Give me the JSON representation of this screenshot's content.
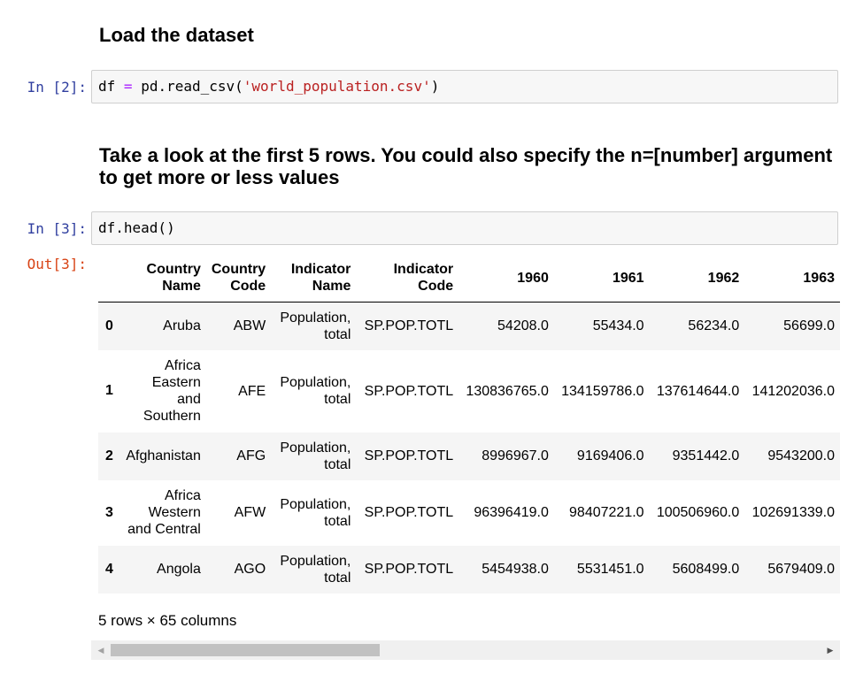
{
  "cells": [
    {
      "kind": "markdown",
      "text": "Load the dataset"
    },
    {
      "kind": "code",
      "prompt": "In [2]:",
      "code": {
        "var": "df",
        "op": "=",
        "call": "pd.read_csv(",
        "arg": "'world_population.csv'",
        "close": ")"
      }
    },
    {
      "kind": "markdown",
      "text": "Take a look at the first 5 rows. You could also specify the n=[number] argument to get more or less values"
    },
    {
      "kind": "code",
      "prompt": "In [3]:",
      "code": {
        "text": "df.head()"
      }
    }
  ],
  "output": {
    "prompt": "Out[3]:",
    "table": {
      "columns": [
        "",
        "Country Name",
        "Country Code",
        "Indicator Name",
        "Indicator Code",
        "1960",
        "1961",
        "1962",
        "1963"
      ],
      "rows": [
        [
          "0",
          "Aruba",
          "ABW",
          "Population, total",
          "SP.POP.TOTL",
          "54208.0",
          "55434.0",
          "56234.0",
          "56699.0"
        ],
        [
          "1",
          "Africa Eastern and Southern",
          "AFE",
          "Population, total",
          "SP.POP.TOTL",
          "130836765.0",
          "134159786.0",
          "137614644.0",
          "141202036.0"
        ],
        [
          "2",
          "Afghanistan",
          "AFG",
          "Population, total",
          "SP.POP.TOTL",
          "8996967.0",
          "9169406.0",
          "9351442.0",
          "9543200.0"
        ],
        [
          "3",
          "Africa Western and Central",
          "AFW",
          "Population, total",
          "SP.POP.TOTL",
          "96396419.0",
          "98407221.0",
          "100506960.0",
          "102691339.0"
        ],
        [
          "4",
          "Angola",
          "AGO",
          "Population, total",
          "SP.POP.TOTL",
          "5454938.0",
          "5531451.0",
          "5608499.0",
          "5679409.0"
        ]
      ]
    },
    "shape_text": "5 rows × 65 columns"
  },
  "scrollbar": {
    "left_arrow": "◀",
    "right_arrow": "▶"
  },
  "colors": {
    "in_prompt": "#303f9f",
    "out_prompt": "#d84315",
    "string": "#ba2121",
    "operator": "#aa22ff"
  }
}
